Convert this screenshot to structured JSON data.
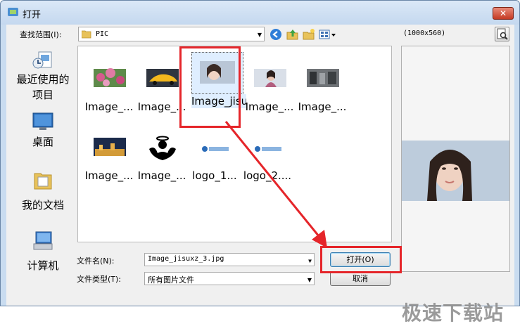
{
  "window": {
    "title": "打开",
    "close_label": "✕"
  },
  "toolbar": {
    "lookin_label": "查找范围(I):",
    "current_folder": "PIC",
    "icons": [
      "back-icon",
      "up-folder-icon",
      "new-folder-icon",
      "view-menu-icon"
    ]
  },
  "places": [
    {
      "label": "最近使用的项目",
      "icon": "recent-items-icon"
    },
    {
      "label": "桌面",
      "icon": "desktop-icon"
    },
    {
      "label": "我的文档",
      "icon": "my-documents-icon"
    },
    {
      "label": "计算机",
      "icon": "computer-icon"
    }
  ],
  "files": [
    {
      "name": "Image_...",
      "thumb": "pink-flowers"
    },
    {
      "name": "Image_...",
      "thumb": "yellow-car"
    },
    {
      "name": "Image_jisuxz_3.jpg",
      "thumb": "portrait",
      "selected": true
    },
    {
      "name": "Image_...",
      "thumb": "woman"
    },
    {
      "name": "Image_...",
      "thumb": "gray-scene"
    },
    {
      "name": "Image_...",
      "thumb": "night-city"
    },
    {
      "name": "Image_...",
      "thumb": "angel-silhouette"
    },
    {
      "name": "logo_1...",
      "thumb": "logo"
    },
    {
      "name": "logo_2....",
      "thumb": "logo"
    }
  ],
  "preview": {
    "size_label": "(1000x560)"
  },
  "form": {
    "filename_label": "文件名(N):",
    "filename_value": "Image_jisuxz_3.jpg",
    "filetype_label": "文件类型(T):",
    "filetype_value": "所有图片文件",
    "open_button": "打开(O)",
    "cancel_button": "取消"
  },
  "watermark": "极速下载站",
  "colors": {
    "highlight": "#e5252a",
    "title_bar": "#c4d8ef"
  }
}
